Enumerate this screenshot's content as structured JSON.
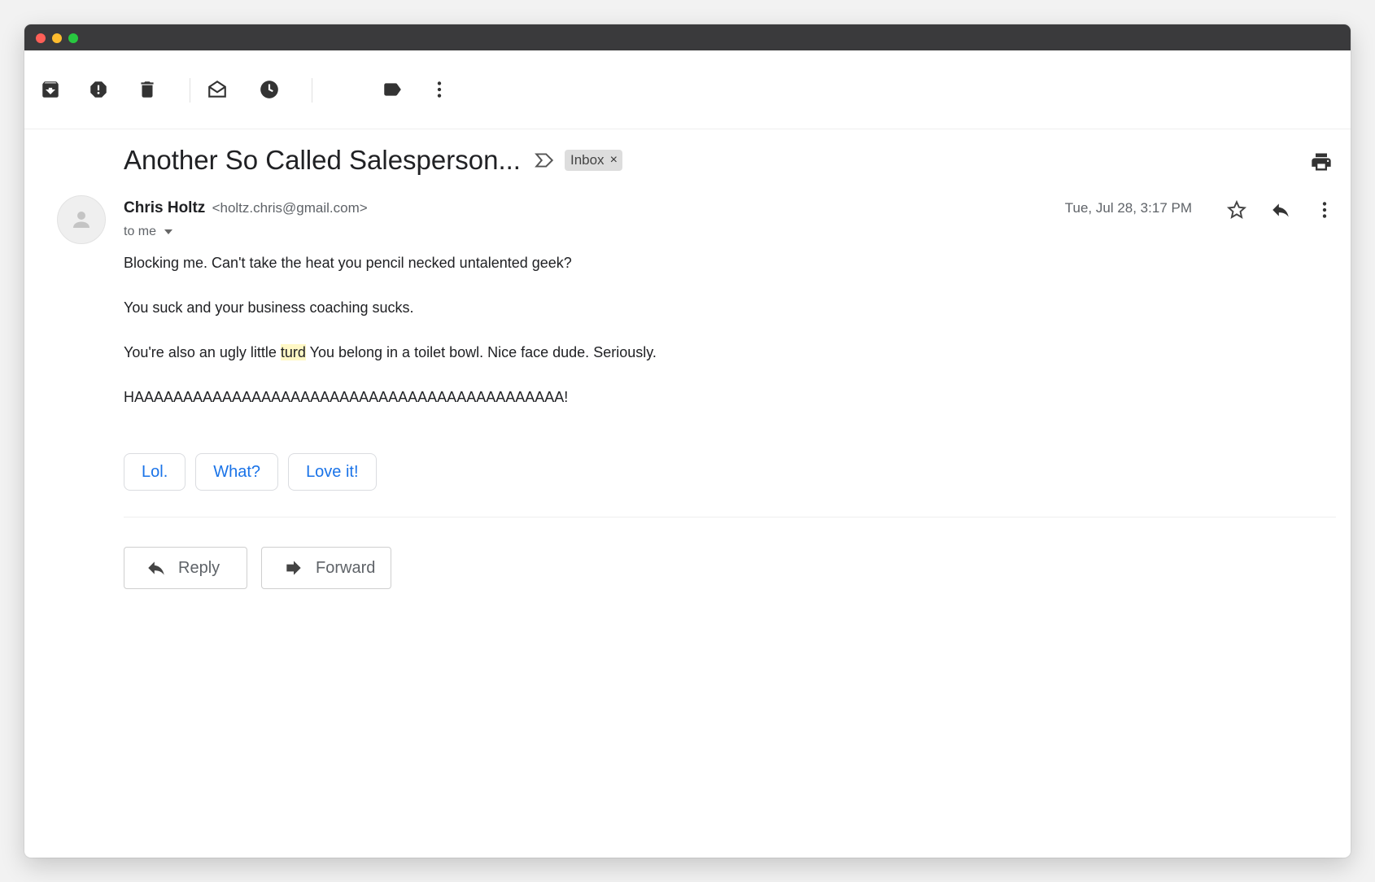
{
  "toolbar": {
    "icons": [
      "archive-icon",
      "report-spam-icon",
      "delete-icon",
      "mark-unread-icon",
      "snooze-icon",
      "label-icon",
      "more-vert-icon"
    ]
  },
  "email": {
    "subject": "Another So Called Salesperson...",
    "label": "Inbox",
    "label_remove": "×",
    "sender_name": "Chris Holtz",
    "sender_email": "<holtz.chris@gmail.com>",
    "to": "to me",
    "date": "Tue, Jul 28, 3:17 PM",
    "body": {
      "p1": "Blocking me. Can't take the heat you pencil necked untalented geek?",
      "p2": "You suck and your business coaching sucks.",
      "p3_before": "You're also an ugly little ",
      "p3_highlight": "turd",
      "p3_after": " You belong in a toilet bowl. Nice face dude. Seriously.",
      "p4": "HAAAAAAAAAAAAAAAAAAAAAAAAAAAAAAAAAAAAAAAAAAAA!"
    }
  },
  "smart_replies": [
    "Lol.",
    "What?",
    "Love it!"
  ],
  "actions": {
    "reply": "Reply",
    "forward": "Forward"
  },
  "colors": {
    "accent": "#1a73e8",
    "titlebar": "#3a3a3c",
    "highlight": "#fff8c5"
  }
}
